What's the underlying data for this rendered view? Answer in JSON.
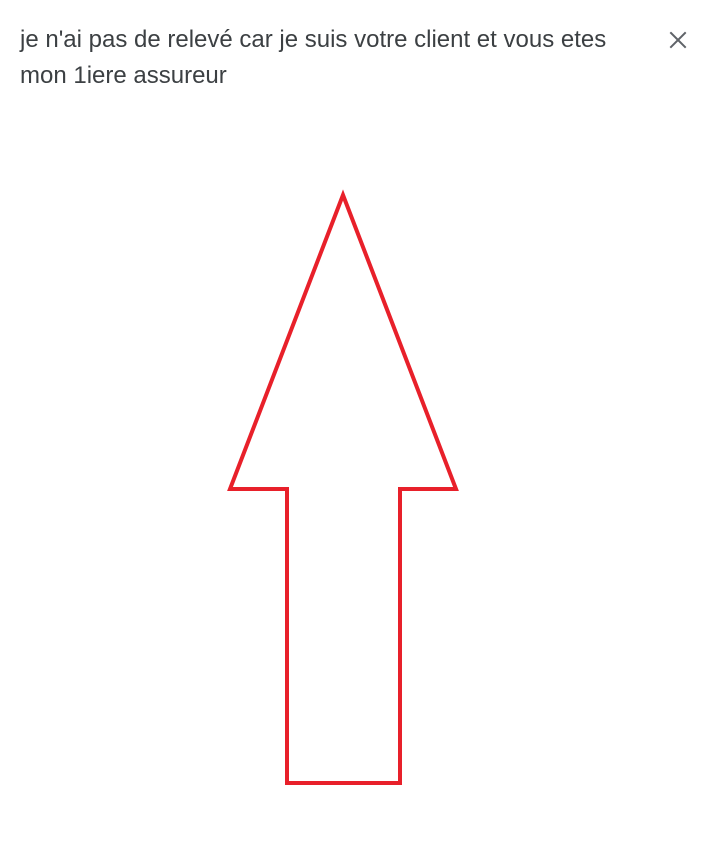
{
  "message": {
    "text": "je n'ai pas de relevé car je suis votre client et vous etes mon 1iere assureur"
  },
  "close_button": {
    "icon": "close-icon"
  },
  "drawing": {
    "shape": "up-arrow-outline",
    "stroke_color": "#e8202a"
  },
  "colors": {
    "text": "#3c4043",
    "icon": "#5f6368",
    "background": "#ffffff"
  }
}
